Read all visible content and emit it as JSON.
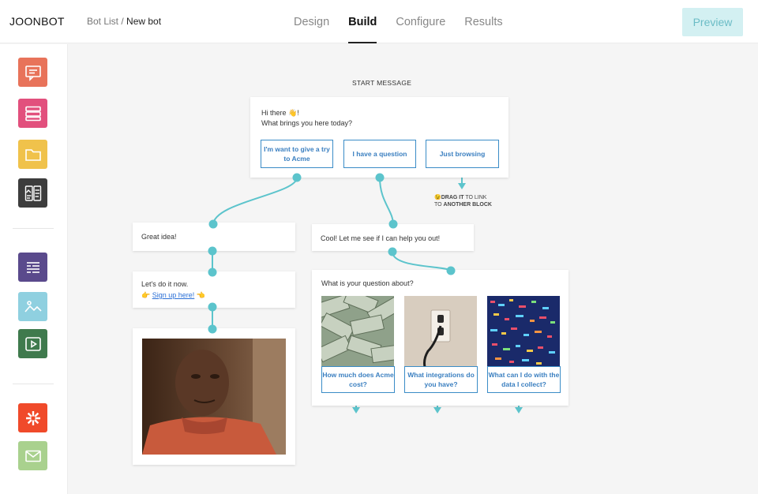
{
  "header": {
    "logo": "JOONBOT",
    "breadcrumb_parent": "Bot List",
    "breadcrumb_sep": " / ",
    "breadcrumb_current": "New bot",
    "tabs": [
      {
        "label": "Design"
      },
      {
        "label": "Build"
      },
      {
        "label": "Configure"
      },
      {
        "label": "Results"
      }
    ],
    "active_tab": "Build",
    "preview_label": "Preview"
  },
  "sidebar": {
    "items": [
      {
        "icon": "message-icon",
        "color": "#e8735a"
      },
      {
        "icon": "stack-icon",
        "color": "#e2507d"
      },
      {
        "icon": "folder-icon",
        "color": "#f0c24b"
      },
      {
        "icon": "gallery-cards-icon",
        "color": "#3d3d3d"
      },
      {
        "icon": "form-icon",
        "color": "#5a4a8c"
      },
      {
        "icon": "image-icon",
        "color": "#8fd0e0"
      },
      {
        "icon": "video-icon",
        "color": "#3f7a4d"
      },
      {
        "icon": "zapier-icon",
        "color": "#f04a2a"
      },
      {
        "icon": "mail-icon",
        "color": "#a9d18e"
      }
    ]
  },
  "flow": {
    "start_label": "START MESSAGE",
    "start": {
      "line1": "Hi there 👋!",
      "line2": "What brings you here today?",
      "choices": [
        "I'm want to give a try to Acme",
        "I have a question",
        "Just browsing"
      ]
    },
    "hint": {
      "emoji": "😉",
      "bold1": "DRAG IT",
      "rest1": " TO LINK",
      "rest2": "TO ",
      "bold2": "ANOTHER BLOCK"
    },
    "great_idea": "Great idea!",
    "lets_do": "Let's do it now.",
    "signup_left": "👉",
    "signup_link": "Sign up here!",
    "signup_right": "👈",
    "cool": "Cool! Let me see if I can help you out!",
    "question": {
      "title": "What is your question about?",
      "options": [
        "How much does Acme cost?",
        "What integrations do you have?",
        "What can I do with the data I collect?"
      ]
    }
  },
  "colors": {
    "wire": "#5cc4cc",
    "choice_border": "#3a8cc7",
    "preview_bg": "#d3f0f2"
  }
}
